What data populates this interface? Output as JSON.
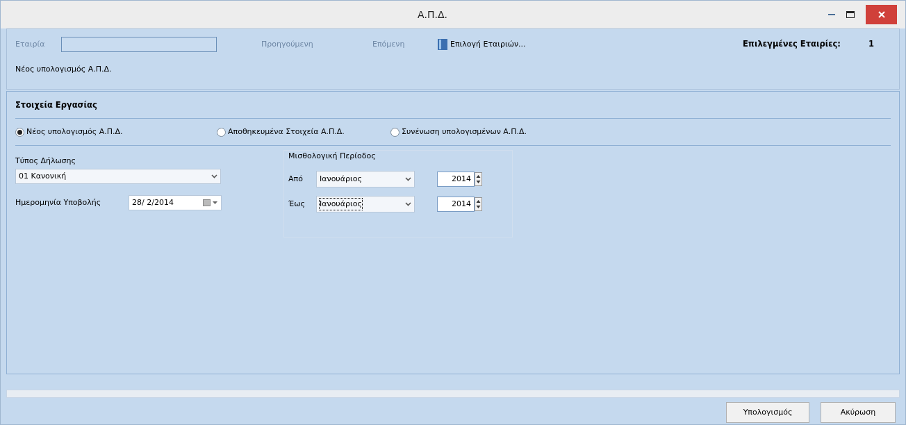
{
  "window": {
    "title": "Α.Π.Δ."
  },
  "toolbar": {
    "company_label": {
      "text": "Εταιρία",
      "disabled": true
    },
    "nav_buttons": [
      {
        "label": "Προηγούμενη",
        "disabled": true
      },
      {
        "label": "Επόμενη",
        "disabled": true
      }
    ],
    "select_button": "Επιλογή Εταιριών...",
    "selected_label": "Επιλεγμένες Εταιρίες:",
    "selected_count": "1",
    "mode_caption": "Νέος υπολογισμός Α.Π.Δ."
  },
  "section": {
    "title": "Στοιχεία Εργασίας",
    "radios": [
      {
        "label": "Νέος υπολογισμός Α.Π.Δ.",
        "selected": true
      },
      {
        "label": "Αποθηκευμένα Στοιχεία Α.Π.Δ.",
        "selected": false
      },
      {
        "label": "Συνένωση υπολογισμένων Α.Π.Δ.",
        "selected": false
      }
    ],
    "declaration_type": {
      "label": "Τύπος Δήλωσης",
      "value": "01 Κανονική"
    },
    "submission_date": {
      "label": "Ημερομηνία Υποβολής",
      "value": "28/ 2/2014"
    },
    "period": {
      "title": "Μισθολογική Περίοδος",
      "rows": [
        {
          "label": "Από",
          "month": "Ιανουάριος",
          "year": "2014",
          "focused": false
        },
        {
          "label": "Έως",
          "month": "Ιανουάριος",
          "year": "2014",
          "focused": true
        }
      ]
    }
  },
  "buttons": [
    "Υπολογισμός",
    "Ακύρωση"
  ]
}
